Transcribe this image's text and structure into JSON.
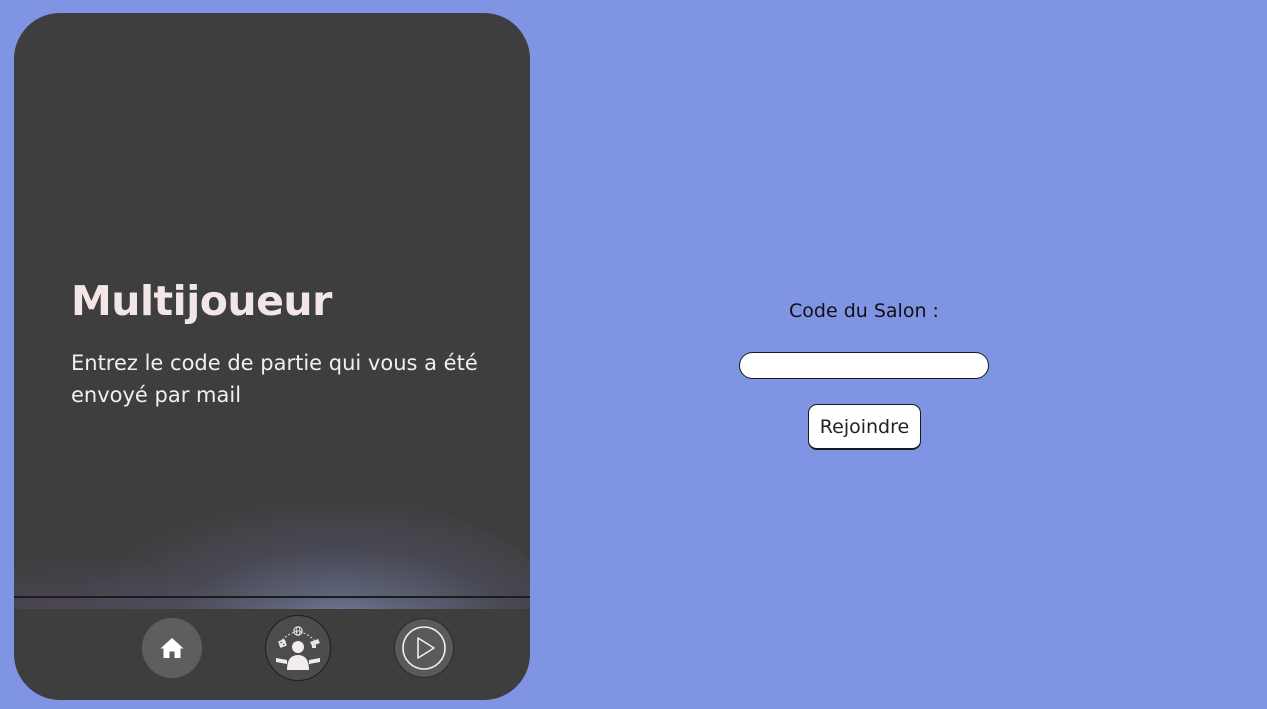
{
  "card": {
    "title": "Multijoueur",
    "subtitle": "Entrez le code de partie qui vous a été envoyé par mail"
  },
  "nav": {
    "items": [
      {
        "icon": "home-icon"
      },
      {
        "icon": "multiplayer-icon"
      },
      {
        "icon": "play-icon"
      }
    ]
  },
  "join": {
    "label": "Code du Salon :",
    "input_value": "",
    "button_label": "Rejoindre"
  },
  "colors": {
    "background": "#7f94e3",
    "card": "#3e3e3e",
    "text_light": "#f3e6e6"
  }
}
